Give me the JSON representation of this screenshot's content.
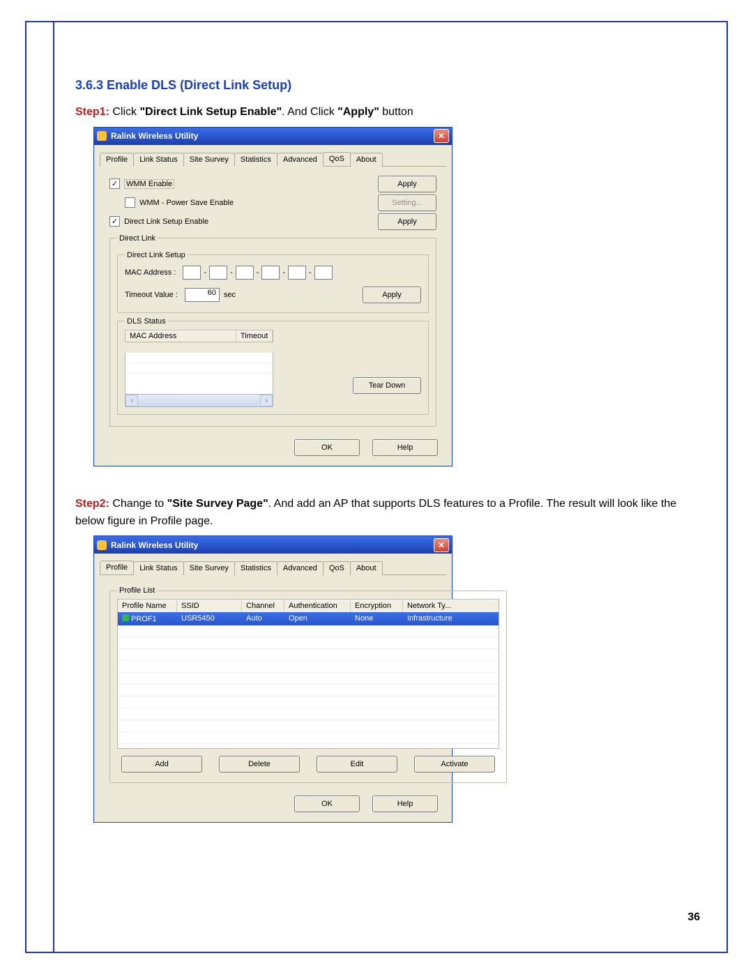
{
  "section_title": "3.6.3 Enable DLS (Direct Link Setup)",
  "step1": {
    "label": "Step1:",
    "text1": " Click ",
    "bold1": "\"Direct Link Setup Enable\"",
    "text2": ". And Click ",
    "bold2": "\"Apply\"",
    "text3": " button"
  },
  "step2": {
    "label": "Step2:",
    "text1": " Change to ",
    "bold1": "\"Site Survey Page\"",
    "text2": ". And add an AP that supports DLS features to a Profile. The result will look like the below figure in Profile page."
  },
  "page_number": "36",
  "win1": {
    "title": "Ralink Wireless Utility",
    "tabs": [
      "Profile",
      "Link Status",
      "Site Survey",
      "Statistics",
      "Advanced",
      "QoS",
      "About"
    ],
    "active_tab": "QoS",
    "wmm_enable": "WMM Enable",
    "wmm_ps": "WMM - Power Save Enable",
    "dls_enable": "Direct Link Setup Enable",
    "apply": "Apply",
    "setting": "Setting...",
    "group_dl": "Direct Link",
    "group_dls": "Direct Link Setup",
    "mac_label": "MAC Address :",
    "timeout_label": "Timeout Value :",
    "timeout_value": "60",
    "timeout_unit": "sec",
    "group_status": "DLS Status",
    "col_mac": "MAC Address",
    "col_timeout": "Timeout",
    "teardown": "Tear Down",
    "ok": "OK",
    "help": "Help"
  },
  "win2": {
    "title": "Ralink Wireless Utility",
    "tabs": [
      "Profile",
      "Link Status",
      "Site Survey",
      "Statistics",
      "Advanced",
      "QoS",
      "About"
    ],
    "active_tab": "Profile",
    "group_profile": "Profile List",
    "cols": {
      "name": "Profile Name",
      "ssid": "SSID",
      "chan": "Channel",
      "auth": "Authentication",
      "enc": "Encryption",
      "net": "Network Ty..."
    },
    "row": {
      "name": "PROF1",
      "ssid": "USR5450",
      "chan": "Auto",
      "auth": "Open",
      "enc": "None",
      "net": "Infrastructure"
    },
    "btn_add": "Add",
    "btn_del": "Delete",
    "btn_edit": "Edit",
    "btn_act": "Activate",
    "ok": "OK",
    "help": "Help"
  }
}
